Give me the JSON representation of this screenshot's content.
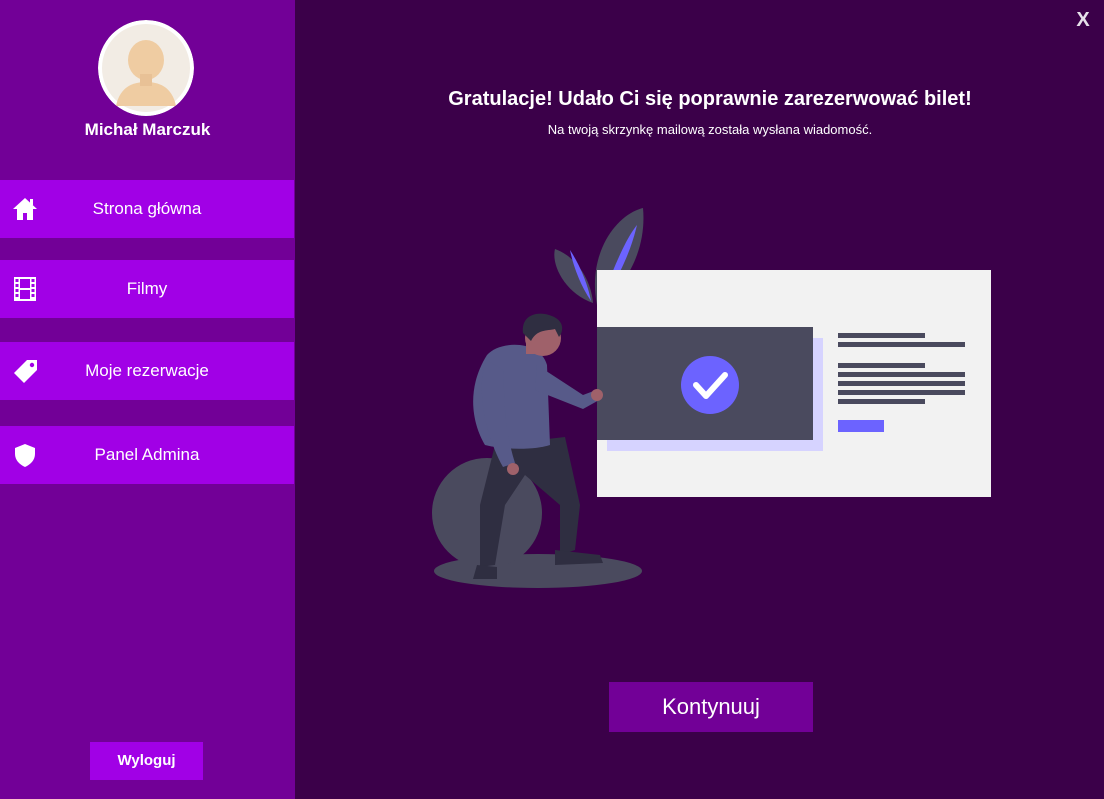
{
  "user": {
    "name": "Michał Marczuk"
  },
  "sidebar": {
    "items": [
      {
        "label": "Strona główna",
        "icon": "home-icon"
      },
      {
        "label": "Filmy",
        "icon": "film-icon"
      },
      {
        "label": "Moje rezerwacje",
        "icon": "tag-icon"
      },
      {
        "label": "Panel Admina",
        "icon": "shield-icon"
      }
    ],
    "logout_label": "Wyloguj"
  },
  "window": {
    "close_label": "X"
  },
  "main": {
    "headline": "Gratulacje! Udało Ci się poprawnie zarezerwować bilet!",
    "subline": "Na twoją skrzynkę mailową została wysłana wiadomość.",
    "continue_label": "Kontynuuj"
  },
  "colors": {
    "sidebar_bg": "#720097",
    "main_bg": "#3b0049",
    "nav_item_bg": "#a100e6",
    "accent": "#6c63ff"
  }
}
